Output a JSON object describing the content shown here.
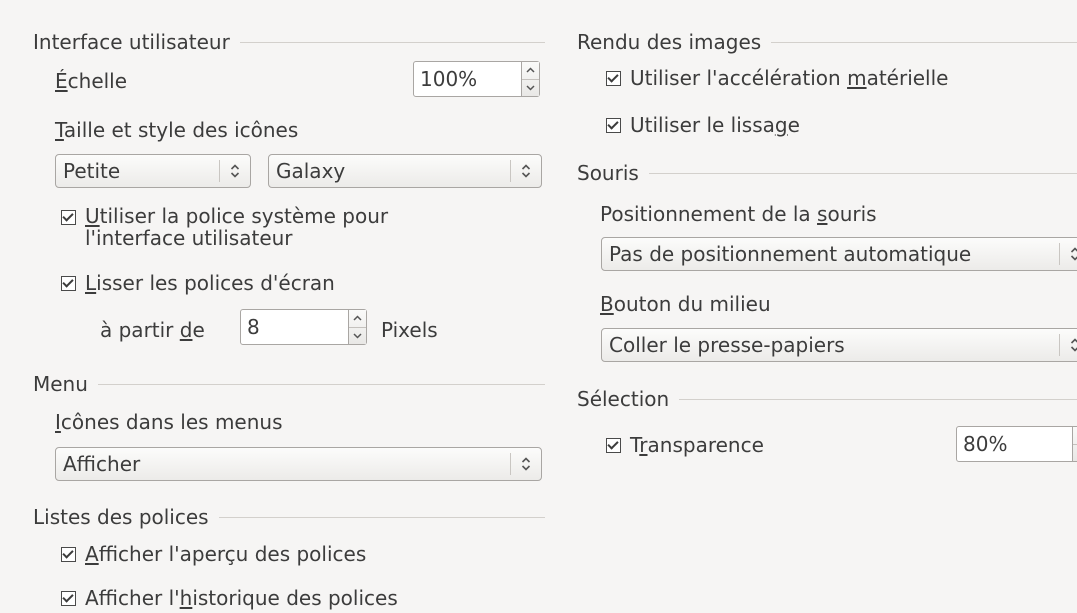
{
  "interface": {
    "title": "Interface utilisateur",
    "scale": {
      "label_prefix": "",
      "label_mnemonic": "É",
      "label_rest": "chelle",
      "value": "100%"
    },
    "icon_size_style": {
      "label_mnemonic": "T",
      "label_rest": "aille et style des icônes",
      "size_value": "Petite",
      "style_value": "Galaxy"
    },
    "system_font": {
      "mnemonic": "U",
      "line1_rest": "tiliser la police système pour",
      "line2": "l'interface utilisateur",
      "checked": true
    },
    "antialias": {
      "mnemonic": "L",
      "rest": "isser les polices d'écran",
      "checked": true
    },
    "from": {
      "prefix": "à partir ",
      "mnemonic": "d",
      "rest": "e",
      "value": "8",
      "unit": "Pixels"
    }
  },
  "menu": {
    "title": "Menu",
    "icons_in_menus": {
      "mnemonic": "I",
      "rest": "cônes dans les menus",
      "value": "Afficher"
    }
  },
  "font_lists": {
    "title": "Listes des polices",
    "preview": {
      "mnemonic": "A",
      "rest": "fficher l'aperçu des polices",
      "checked": true
    },
    "history": {
      "prefix": "Afficher l'",
      "mnemonic": "h",
      "rest": "istorique des polices",
      "checked": true
    }
  },
  "graphics_output": {
    "title": "Rendu des images",
    "hw_accel": {
      "prefix": "Utiliser l'accélération ",
      "mnemonic": "m",
      "rest": "atérielle",
      "checked": true
    },
    "antialiasing": {
      "prefix": "Utiliser le lissa",
      "mnemonic": "g",
      "rest": "e",
      "checked": true
    }
  },
  "mouse": {
    "title": "Souris",
    "positioning": {
      "prefix": "Positionnement de la ",
      "mnemonic": "s",
      "rest": "ouris",
      "value": "Pas de positionnement automatique"
    },
    "middle_button": {
      "mnemonic": "B",
      "rest": "outon du milieu",
      "value": "Coller le presse-papiers"
    }
  },
  "selection": {
    "title": "Sélection",
    "transparency": {
      "prefix": "T",
      "mnemonic": "r",
      "rest": "ansparence",
      "checked": true,
      "value": "80%"
    }
  }
}
